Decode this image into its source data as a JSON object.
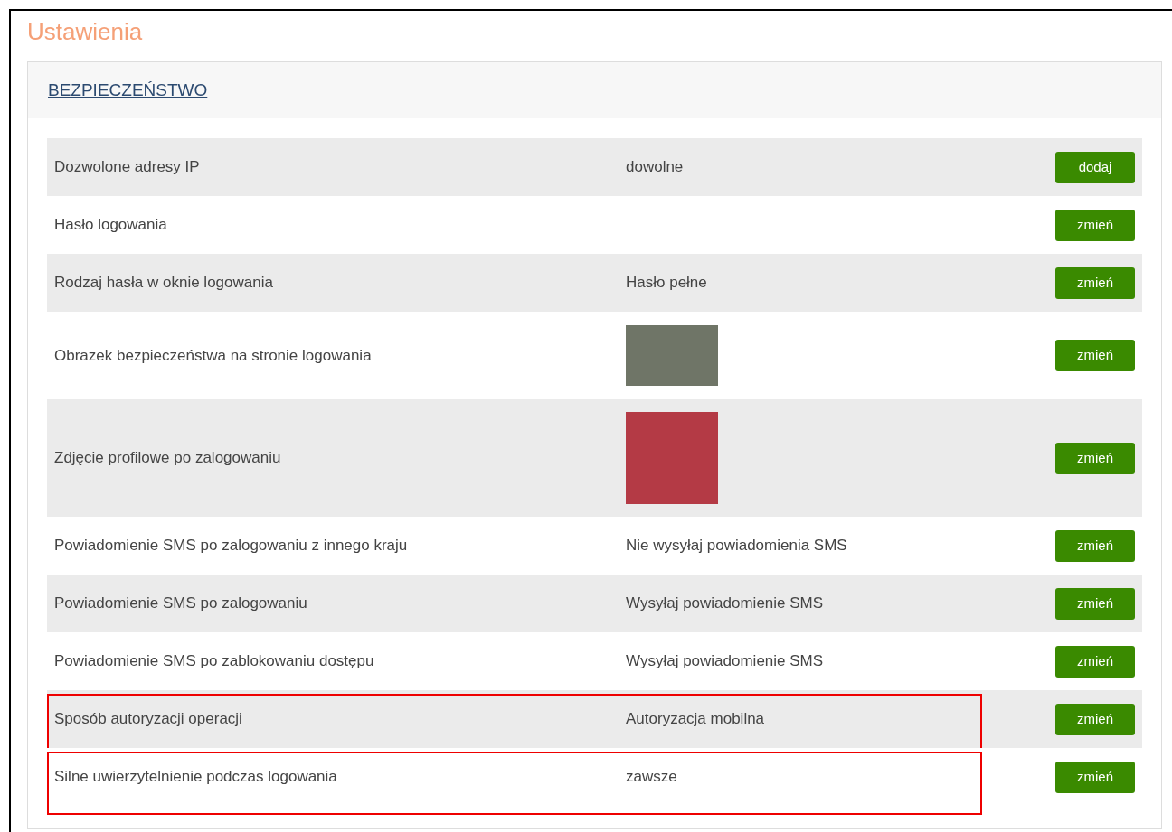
{
  "page": {
    "title": "Ustawienia"
  },
  "section": {
    "heading": "BEZPIECZEŃSTWO"
  },
  "rows": [
    {
      "label": "Dozwolone adresy IP",
      "kind": "text",
      "value": "dowolne",
      "button": "dodaj",
      "highlighted": false
    },
    {
      "label": "Hasło logowania",
      "kind": "text",
      "value": null,
      "button": "zmień",
      "highlighted": false
    },
    {
      "label": "Rodzaj hasła w oknie logowania",
      "kind": "text",
      "value": "Hasło pełne",
      "button": "zmień",
      "highlighted": false
    },
    {
      "label": "Obrazek bezpieczeństwa na stronie logowania",
      "kind": "image-wide",
      "button": "zmień",
      "highlighted": false
    },
    {
      "label": "Zdjęcie profilowe po zalogowaniu",
      "kind": "image-square",
      "button": "zmień",
      "highlighted": false
    },
    {
      "label": "Powiadomienie SMS po zalogowaniu z innego kraju",
      "kind": "text",
      "value": "Nie wysyłaj powiadomienia SMS",
      "button": "zmień",
      "highlighted": false
    },
    {
      "label": "Powiadomienie SMS po zalogowaniu",
      "kind": "text",
      "value": "Wysyłaj powiadomienie SMS",
      "button": "zmień",
      "highlighted": false
    },
    {
      "label": "Powiadomienie SMS po zablokowaniu dostępu",
      "kind": "text",
      "value": "Wysyłaj powiadomienie SMS",
      "button": "zmień",
      "highlighted": false
    },
    {
      "label": "Sposób autoryzacji operacji",
      "kind": "text",
      "value": "Autoryzacja mobilna",
      "button": "zmień",
      "highlighted": true
    },
    {
      "label": "Silne uwierzytelnienie podczas logowania",
      "kind": "text",
      "value": "zawsze",
      "button": "zmień",
      "highlighted": true
    }
  ]
}
